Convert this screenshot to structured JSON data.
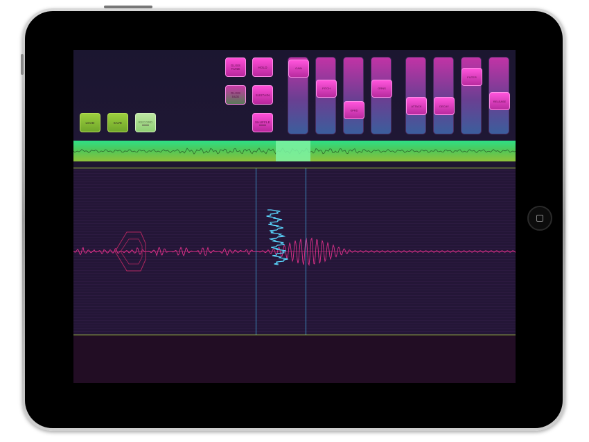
{
  "device": {
    "frame_color": "#c9c9c9",
    "bezel_color": "#000000"
  },
  "pads_left": [
    {
      "label": "LOAD",
      "sub": ""
    },
    {
      "label": "SAVE",
      "sub": ""
    },
    {
      "label": "RECORD",
      "sub": ""
    }
  ],
  "pads_grid": [
    {
      "label": "GLISS",
      "sub": "TUNE"
    },
    {
      "label": "HOLD",
      "sub": ""
    },
    {
      "label": "GLISS",
      "sub": "SIZE"
    },
    {
      "label": "SUSTAIN",
      "sub": ""
    },
    {
      "label": "SHUFFLE",
      "sub": ""
    }
  ],
  "sliders": [
    {
      "label": "GAIN",
      "value": 0.97
    },
    {
      "label": "PITCH",
      "value": 0.62
    },
    {
      "label": "SPRD",
      "value": 0.25
    },
    {
      "label": "GRNS",
      "value": 0.62
    },
    {
      "label": "ATTACK",
      "value": 0.32
    },
    {
      "label": "DECAY",
      "value": 0.32
    },
    {
      "label": "FILTER",
      "value": 0.82
    },
    {
      "label": "RELEASE",
      "value": 0.4
    }
  ],
  "colors": {
    "accent_pink": "#ff3cc8",
    "waveform_pink": "#e0308a",
    "grain_blue": "#5ad8ff",
    "overview_green": "#4ec859",
    "cursor_blue": "#3b8cc0"
  }
}
